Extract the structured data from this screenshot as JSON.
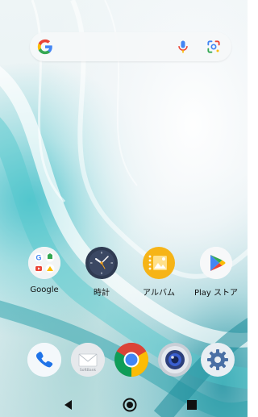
{
  "home": {
    "apps": [
      {
        "id": "google",
        "label": "Google",
        "icon": "google-folder-icon"
      },
      {
        "id": "clock",
        "label": "時計",
        "icon": "clock-icon"
      },
      {
        "id": "album",
        "label": "アルバム",
        "icon": "album-icon"
      },
      {
        "id": "play",
        "label": "Play ストア",
        "icon": "play-store-icon"
      }
    ],
    "dock": [
      {
        "id": "phone",
        "icon": "phone-icon"
      },
      {
        "id": "mail",
        "icon": "softbank-mail-icon",
        "text": "SoftBank"
      },
      {
        "id": "chrome",
        "icon": "chrome-icon"
      },
      {
        "id": "camera",
        "icon": "camera-icon"
      },
      {
        "id": "settings",
        "icon": "settings-icon"
      }
    ]
  },
  "search": {
    "icons": [
      "google-g-icon",
      "mic-icon",
      "google-lens-icon"
    ]
  },
  "nav": {
    "buttons": [
      "back-icon",
      "home-icon",
      "recents-icon"
    ]
  },
  "colors": {
    "google_blue": "#4285F4",
    "google_red": "#EA4335",
    "google_yellow": "#FBBC05",
    "google_green": "#34A853",
    "wallpaper_teal": "#3cbcc8"
  }
}
